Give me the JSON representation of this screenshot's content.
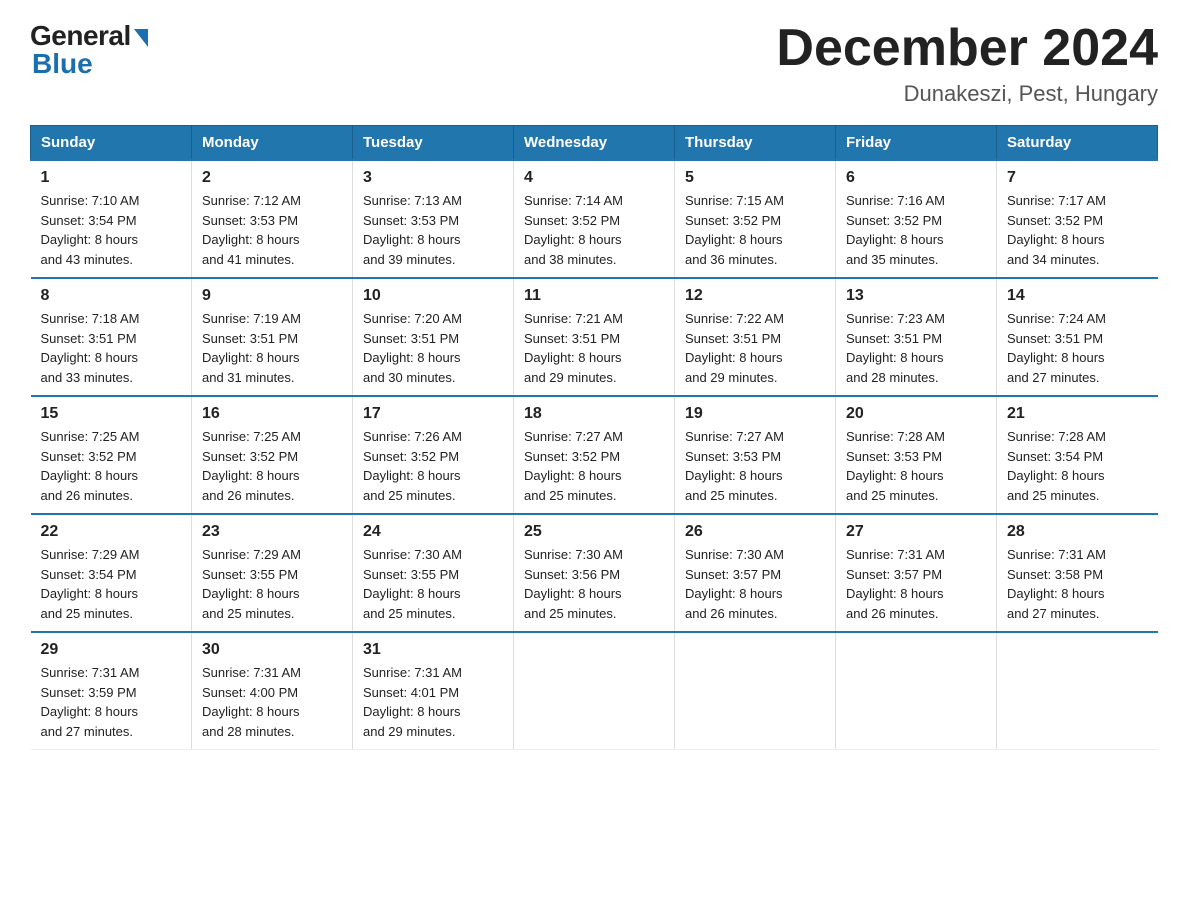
{
  "header": {
    "logo_general": "General",
    "logo_blue": "Blue",
    "month_title": "December 2024",
    "location": "Dunakeszi, Pest, Hungary"
  },
  "days_of_week": [
    "Sunday",
    "Monday",
    "Tuesday",
    "Wednesday",
    "Thursday",
    "Friday",
    "Saturday"
  ],
  "weeks": [
    [
      {
        "day": "1",
        "sunrise": "7:10 AM",
        "sunset": "3:54 PM",
        "daylight": "8 hours and 43 minutes."
      },
      {
        "day": "2",
        "sunrise": "7:12 AM",
        "sunset": "3:53 PM",
        "daylight": "8 hours and 41 minutes."
      },
      {
        "day": "3",
        "sunrise": "7:13 AM",
        "sunset": "3:53 PM",
        "daylight": "8 hours and 39 minutes."
      },
      {
        "day": "4",
        "sunrise": "7:14 AM",
        "sunset": "3:52 PM",
        "daylight": "8 hours and 38 minutes."
      },
      {
        "day": "5",
        "sunrise": "7:15 AM",
        "sunset": "3:52 PM",
        "daylight": "8 hours and 36 minutes."
      },
      {
        "day": "6",
        "sunrise": "7:16 AM",
        "sunset": "3:52 PM",
        "daylight": "8 hours and 35 minutes."
      },
      {
        "day": "7",
        "sunrise": "7:17 AM",
        "sunset": "3:52 PM",
        "daylight": "8 hours and 34 minutes."
      }
    ],
    [
      {
        "day": "8",
        "sunrise": "7:18 AM",
        "sunset": "3:51 PM",
        "daylight": "8 hours and 33 minutes."
      },
      {
        "day": "9",
        "sunrise": "7:19 AM",
        "sunset": "3:51 PM",
        "daylight": "8 hours and 31 minutes."
      },
      {
        "day": "10",
        "sunrise": "7:20 AM",
        "sunset": "3:51 PM",
        "daylight": "8 hours and 30 minutes."
      },
      {
        "day": "11",
        "sunrise": "7:21 AM",
        "sunset": "3:51 PM",
        "daylight": "8 hours and 29 minutes."
      },
      {
        "day": "12",
        "sunrise": "7:22 AM",
        "sunset": "3:51 PM",
        "daylight": "8 hours and 29 minutes."
      },
      {
        "day": "13",
        "sunrise": "7:23 AM",
        "sunset": "3:51 PM",
        "daylight": "8 hours and 28 minutes."
      },
      {
        "day": "14",
        "sunrise": "7:24 AM",
        "sunset": "3:51 PM",
        "daylight": "8 hours and 27 minutes."
      }
    ],
    [
      {
        "day": "15",
        "sunrise": "7:25 AM",
        "sunset": "3:52 PM",
        "daylight": "8 hours and 26 minutes."
      },
      {
        "day": "16",
        "sunrise": "7:25 AM",
        "sunset": "3:52 PM",
        "daylight": "8 hours and 26 minutes."
      },
      {
        "day": "17",
        "sunrise": "7:26 AM",
        "sunset": "3:52 PM",
        "daylight": "8 hours and 25 minutes."
      },
      {
        "day": "18",
        "sunrise": "7:27 AM",
        "sunset": "3:52 PM",
        "daylight": "8 hours and 25 minutes."
      },
      {
        "day": "19",
        "sunrise": "7:27 AM",
        "sunset": "3:53 PM",
        "daylight": "8 hours and 25 minutes."
      },
      {
        "day": "20",
        "sunrise": "7:28 AM",
        "sunset": "3:53 PM",
        "daylight": "8 hours and 25 minutes."
      },
      {
        "day": "21",
        "sunrise": "7:28 AM",
        "sunset": "3:54 PM",
        "daylight": "8 hours and 25 minutes."
      }
    ],
    [
      {
        "day": "22",
        "sunrise": "7:29 AM",
        "sunset": "3:54 PM",
        "daylight": "8 hours and 25 minutes."
      },
      {
        "day": "23",
        "sunrise": "7:29 AM",
        "sunset": "3:55 PM",
        "daylight": "8 hours and 25 minutes."
      },
      {
        "day": "24",
        "sunrise": "7:30 AM",
        "sunset": "3:55 PM",
        "daylight": "8 hours and 25 minutes."
      },
      {
        "day": "25",
        "sunrise": "7:30 AM",
        "sunset": "3:56 PM",
        "daylight": "8 hours and 25 minutes."
      },
      {
        "day": "26",
        "sunrise": "7:30 AM",
        "sunset": "3:57 PM",
        "daylight": "8 hours and 26 minutes."
      },
      {
        "day": "27",
        "sunrise": "7:31 AM",
        "sunset": "3:57 PM",
        "daylight": "8 hours and 26 minutes."
      },
      {
        "day": "28",
        "sunrise": "7:31 AM",
        "sunset": "3:58 PM",
        "daylight": "8 hours and 27 minutes."
      }
    ],
    [
      {
        "day": "29",
        "sunrise": "7:31 AM",
        "sunset": "3:59 PM",
        "daylight": "8 hours and 27 minutes."
      },
      {
        "day": "30",
        "sunrise": "7:31 AM",
        "sunset": "4:00 PM",
        "daylight": "8 hours and 28 minutes."
      },
      {
        "day": "31",
        "sunrise": "7:31 AM",
        "sunset": "4:01 PM",
        "daylight": "8 hours and 29 minutes."
      },
      null,
      null,
      null,
      null
    ]
  ],
  "labels": {
    "sunrise_prefix": "Sunrise: ",
    "sunset_prefix": "Sunset: ",
    "daylight_prefix": "Daylight: "
  }
}
